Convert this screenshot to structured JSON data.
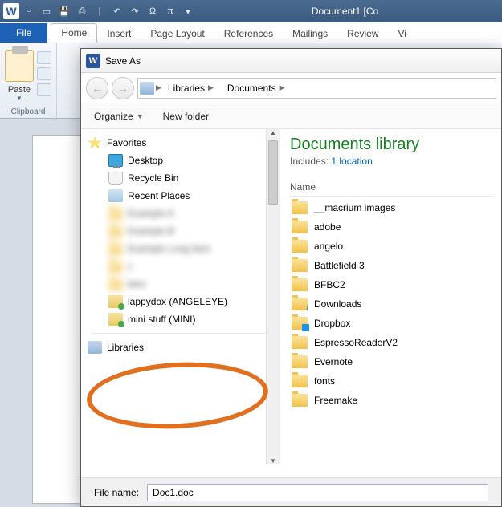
{
  "titlebar": {
    "doc_title": "Document1 [Co"
  },
  "ribbon": {
    "file": "File",
    "tabs": [
      "Home",
      "Insert",
      "Page Layout",
      "References",
      "Mailings",
      "Review",
      "Vi"
    ],
    "paste": "Paste",
    "clipboard": "Clipboard"
  },
  "dialog": {
    "title": "Save As",
    "breadcrumb": [
      "Libraries",
      "Documents"
    ],
    "organize": "Organize",
    "new_folder": "New folder",
    "nav": {
      "favorites": "Favorites",
      "items": [
        "Desktop",
        "Recycle Bin",
        "Recent Places"
      ],
      "blurred": [
        "Example A",
        "Example B",
        "Example Long Item",
        "c",
        "item"
      ],
      "network": [
        "lappydox (ANGELEYE)",
        "mini stuff (MINI)"
      ],
      "libraries": "Libraries"
    },
    "content": {
      "heading": "Documents library",
      "includes_label": "Includes:",
      "includes_link": "1 location",
      "col_name": "Name",
      "folders": [
        "__macrium images",
        "adobe",
        "angelo",
        "Battlefield 3",
        "BFBC2",
        "Downloads",
        "Dropbox",
        "EspressoReaderV2",
        "Evernote",
        "fonts",
        "Freemake"
      ]
    },
    "filename_label": "File name:",
    "filename_value": "Doc1.doc"
  }
}
